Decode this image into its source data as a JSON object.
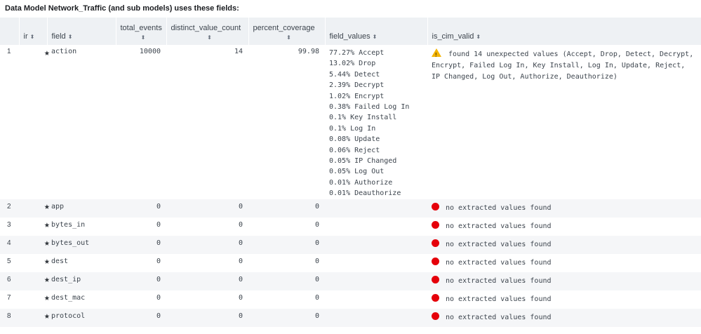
{
  "title": "Data Model Network_Traffic (and sub models) uses these fields:",
  "columns": {
    "ir": "ir",
    "field": "field",
    "total_events": "total_events",
    "distinct_value_count": "distinct_value_count",
    "percent_coverage": "percent_coverage",
    "field_values": "field_values",
    "is_cim_valid": "is_cim_valid"
  },
  "icons": {
    "sort": "sort-icon",
    "star": "star-icon",
    "warning": "warning-icon",
    "error": "error-dot-icon"
  },
  "colors": {
    "warning": "#f4b400",
    "error": "#e5000a",
    "header_bg": "#eef1f4"
  },
  "rows": [
    {
      "num": "1",
      "field": "action",
      "total_events": "10000",
      "distinct_value_count": "14",
      "percent_coverage": "99.98",
      "field_values": [
        "77.27% Accept",
        "13.02% Drop",
        "5.44% Detect",
        "2.39% Decrypt",
        "1.02% Encrypt",
        "0.38% Failed Log In",
        "0.1% Key Install",
        "0.1% Log In",
        "0.08% Update",
        "0.06% Reject",
        "0.05% IP Changed",
        "0.05% Log Out",
        "0.01% Authorize",
        "0.01% Deauthorize"
      ],
      "status": "warning",
      "is_cim_valid": "found 14 unexpected values (Accept, Drop, Detect, Decrypt, Encrypt, Failed Log In, Key Install, Log In, Update, Reject, IP Changed, Log Out, Authorize, Deauthorize)"
    },
    {
      "num": "2",
      "field": "app",
      "total_events": "0",
      "distinct_value_count": "0",
      "percent_coverage": "0",
      "field_values": [],
      "status": "error",
      "is_cim_valid": "no extracted values found"
    },
    {
      "num": "3",
      "field": "bytes_in",
      "total_events": "0",
      "distinct_value_count": "0",
      "percent_coverage": "0",
      "field_values": [],
      "status": "error",
      "is_cim_valid": "no extracted values found"
    },
    {
      "num": "4",
      "field": "bytes_out",
      "total_events": "0",
      "distinct_value_count": "0",
      "percent_coverage": "0",
      "field_values": [],
      "status": "error",
      "is_cim_valid": "no extracted values found"
    },
    {
      "num": "5",
      "field": "dest",
      "total_events": "0",
      "distinct_value_count": "0",
      "percent_coverage": "0",
      "field_values": [],
      "status": "error",
      "is_cim_valid": "no extracted values found"
    },
    {
      "num": "6",
      "field": "dest_ip",
      "total_events": "0",
      "distinct_value_count": "0",
      "percent_coverage": "0",
      "field_values": [],
      "status": "error",
      "is_cim_valid": "no extracted values found"
    },
    {
      "num": "7",
      "field": "dest_mac",
      "total_events": "0",
      "distinct_value_count": "0",
      "percent_coverage": "0",
      "field_values": [],
      "status": "error",
      "is_cim_valid": "no extracted values found"
    },
    {
      "num": "8",
      "field": "protocol",
      "total_events": "0",
      "distinct_value_count": "0",
      "percent_coverage": "0",
      "field_values": [],
      "status": "error",
      "is_cim_valid": "no extracted values found"
    }
  ]
}
